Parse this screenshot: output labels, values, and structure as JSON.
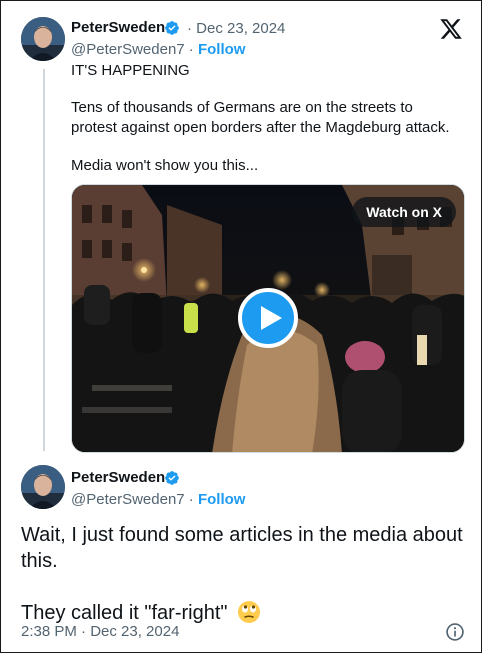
{
  "tweet": {
    "author_name": "PeterSweden",
    "date": "· Dec 23, 2024",
    "handle": "@PeterSweden7",
    "follow_separator": " · ",
    "follow_label": "Follow",
    "text_line1": "IT'S HAPPENING",
    "text_paragraph2": "Tens of thousands of Germans are on the streets to protest against open borders after the Magdeburg attack.",
    "text_paragraph3": "Media won't show you this...",
    "video": {
      "watch_label": "Watch on X",
      "play_icon": "play-icon"
    }
  },
  "reply": {
    "author_name": "PeterSweden",
    "handle": "@PeterSweden7",
    "follow_separator": " · ",
    "follow_label": "Follow",
    "text_paragraph1": "Wait, I just found some articles in the media about this.",
    "text_paragraph2": "They called it \"far-right\"",
    "emoji": "rolling-eyes-emoji",
    "timestamp": "2:38 PM · Dec 23, 2024"
  },
  "icons": {
    "verified": "verified-badge-icon",
    "logo": "x-logo-icon",
    "info": "info-icon"
  },
  "colors": {
    "accent": "#1d9bf0",
    "secondary_text": "#536471",
    "primary_text": "#0f1419"
  }
}
